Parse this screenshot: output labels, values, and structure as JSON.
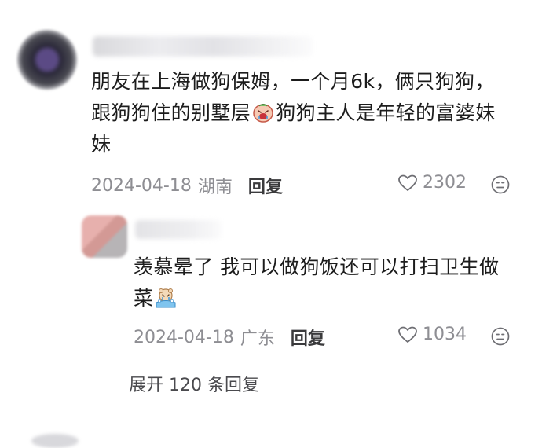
{
  "comment": {
    "text_line1": "朋友在上海做狗保姆，一个月6k，俩只狗狗，",
    "text_line2a": "跟狗狗住的别墅层",
    "text_line2b": "狗狗主人是年轻的富婆妹",
    "text_line3": "妹",
    "emoji": "crying-face-sticker",
    "date": "2024-04-18",
    "region": "湖南",
    "reply_label": "回复",
    "likes": "2302"
  },
  "reply": {
    "text_line1": "羡慕晕了 我可以做狗饭还可以打扫卫生做",
    "text_line2": "菜",
    "emoji": "bathing-bear-sticker",
    "date": "2024-04-18",
    "region": "广东",
    "reply_label": "回复",
    "likes": "1034"
  },
  "expand": {
    "label": "展开 120 条回复"
  },
  "icons": {
    "like": "heart-outline-icon",
    "dislike": "frown-face-icon"
  },
  "colors": {
    "text": "#1c1c1c",
    "meta": "#8e8e93",
    "reply_action": "#3a3a3c"
  }
}
